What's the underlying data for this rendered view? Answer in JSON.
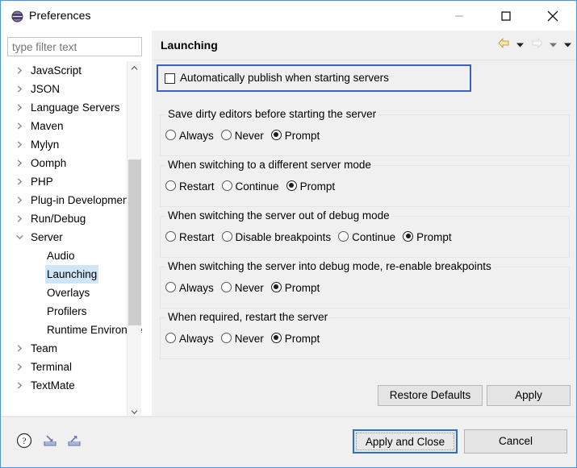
{
  "window": {
    "title": "Preferences",
    "icon": "preferences-icon",
    "controls": {
      "minimize": "minimize-icon",
      "maximize": "maximize-icon",
      "close": "close-icon"
    }
  },
  "sidebar": {
    "filter": {
      "value": "",
      "placeholder": "type filter text"
    },
    "items": [
      {
        "label": "JavaScript",
        "level": 0,
        "state": "collapsed",
        "selected": false
      },
      {
        "label": "JSON",
        "level": 0,
        "state": "collapsed",
        "selected": false
      },
      {
        "label": "Language Servers",
        "level": 0,
        "state": "collapsed",
        "selected": false
      },
      {
        "label": "Maven",
        "level": 0,
        "state": "collapsed",
        "selected": false
      },
      {
        "label": "Mylyn",
        "level": 0,
        "state": "collapsed",
        "selected": false
      },
      {
        "label": "Oomph",
        "level": 0,
        "state": "collapsed",
        "selected": false
      },
      {
        "label": "PHP",
        "level": 0,
        "state": "collapsed",
        "selected": false
      },
      {
        "label": "Plug-in Development",
        "level": 0,
        "state": "collapsed",
        "selected": false
      },
      {
        "label": "Run/Debug",
        "level": 0,
        "state": "collapsed",
        "selected": false
      },
      {
        "label": "Server",
        "level": 0,
        "state": "expanded",
        "selected": false
      },
      {
        "label": "Audio",
        "level": 1,
        "state": "leaf",
        "selected": false
      },
      {
        "label": "Launching",
        "level": 1,
        "state": "leaf",
        "selected": true
      },
      {
        "label": "Overlays",
        "level": 1,
        "state": "leaf",
        "selected": false
      },
      {
        "label": "Profilers",
        "level": 1,
        "state": "leaf",
        "selected": false
      },
      {
        "label": "Runtime Environments",
        "level": 1,
        "state": "leaf",
        "selected": false
      },
      {
        "label": "Team",
        "level": 0,
        "state": "collapsed",
        "selected": false
      },
      {
        "label": "Terminal",
        "level": 0,
        "state": "collapsed",
        "selected": false
      },
      {
        "label": "TextMate",
        "level": 0,
        "state": "collapsed",
        "selected": false
      }
    ]
  },
  "page": {
    "title": "Launching",
    "nav": {
      "back": "back-arrow-icon",
      "back_menu": "chevron-down-icon",
      "forward": "forward-arrow-icon",
      "forward_menu": "chevron-down-icon",
      "view_menu": "chevron-down-icon",
      "back_enabled": true,
      "forward_enabled": false
    },
    "auto_publish": {
      "label": "Automatically publish when starting servers",
      "checked": false,
      "focused": true
    },
    "groups": [
      {
        "title": "Save dirty editors before starting the server",
        "options": [
          {
            "label": "Always",
            "selected": false
          },
          {
            "label": "Never",
            "selected": false
          },
          {
            "label": "Prompt",
            "selected": true
          }
        ]
      },
      {
        "title": "When switching to a different server mode",
        "options": [
          {
            "label": "Restart",
            "selected": false
          },
          {
            "label": "Continue",
            "selected": false
          },
          {
            "label": "Prompt",
            "selected": true
          }
        ]
      },
      {
        "title": "When switching the server out of debug mode",
        "options": [
          {
            "label": "Restart",
            "selected": false
          },
          {
            "label": "Disable breakpoints",
            "selected": false
          },
          {
            "label": "Continue",
            "selected": false
          },
          {
            "label": "Prompt",
            "selected": true
          }
        ]
      },
      {
        "title": "When switching the server into debug mode, re-enable breakpoints",
        "options": [
          {
            "label": "Always",
            "selected": false
          },
          {
            "label": "Never",
            "selected": false
          },
          {
            "label": "Prompt",
            "selected": true
          }
        ]
      },
      {
        "title": "When required, restart the server",
        "options": [
          {
            "label": "Always",
            "selected": false
          },
          {
            "label": "Never",
            "selected": false
          },
          {
            "label": "Prompt",
            "selected": true
          }
        ]
      }
    ],
    "restore_defaults_label": "Restore Defaults",
    "apply_label": "Apply"
  },
  "footer": {
    "help_icon": "help-icon",
    "import_icon": "import-icon",
    "export_icon": "export-icon",
    "apply_and_close_label": "Apply and Close",
    "cancel_label": "Cancel"
  },
  "colors": {
    "window_border": "#4d96d4",
    "focus_border": "#3b5fc0",
    "default_button_border": "#2a6fc9",
    "selection": "#cfe6f8",
    "nav_back": "#e8d88a",
    "nav_forward_disabled": "#e0e0e0"
  }
}
